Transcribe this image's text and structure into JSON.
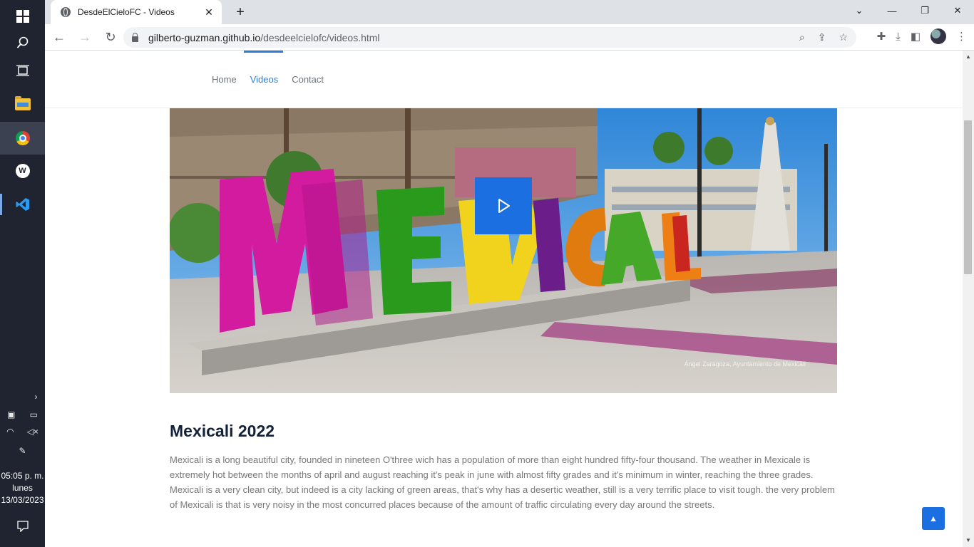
{
  "taskbar": {
    "clock_time": "05:05 p. m.",
    "clock_day": "lunes",
    "clock_date": "13/03/2023"
  },
  "browser": {
    "tab_title": "DesdeElCieloFC - Videos",
    "url_host": "gilberto-guzman.github.io",
    "url_path": "/desdeelcielofc/videos.html"
  },
  "site": {
    "nav": [
      "Home",
      "Videos",
      "Contact"
    ],
    "active_nav": "Videos"
  },
  "video": {
    "title": "Mexicali 2022",
    "description": "Mexicali is a long beautiful city, founded in nineteen O'three wich has a population of more than eight hundred fifty-four thousand. The weather in Mexicale is extremely hot between the months of april and august reaching it's peak in june with almost fifty grades and it's minimum in winter, reaching the three grades. Mexicali is a very clean city, but indeed is a city lacking of green areas, that's why has a desertic weather, still is a very terrific place to visit tough. the very problem of Mexicali is that is very noisy in the most concurred places because of the amount of traffic circulating every day around the streets.",
    "photo_credit": "Ángel Zaragoza, Ayuntamiento de Mexicali",
    "hero_letters": [
      "M",
      "E",
      "X",
      "I",
      "C",
      "A",
      "L",
      "I"
    ]
  },
  "colors": {
    "accent": "#2f7fd6",
    "play_button": "#1b6fe0",
    "title": "#13213a"
  }
}
